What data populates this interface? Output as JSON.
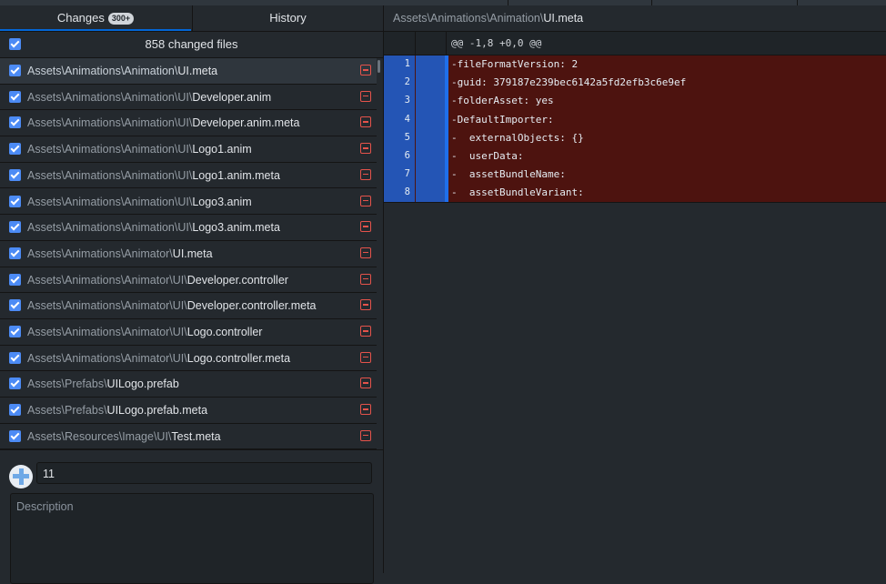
{
  "tabs": {
    "changes_label": "Changes",
    "changes_badge": "300+",
    "history_label": "History"
  },
  "changes_header": {
    "count_text": "858 changed files"
  },
  "files": [
    {
      "dir": "Assets\\Animations\\Animation\\",
      "name": "UI.meta",
      "selected": true
    },
    {
      "dir": "Assets\\Animations\\Animation\\UI\\",
      "name": "Developer.anim",
      "selected": false
    },
    {
      "dir": "Assets\\Animations\\Animation\\UI\\",
      "name": "Developer.anim.meta",
      "selected": false
    },
    {
      "dir": "Assets\\Animations\\Animation\\UI\\",
      "name": "Logo1.anim",
      "selected": false
    },
    {
      "dir": "Assets\\Animations\\Animation\\UI\\",
      "name": "Logo1.anim.meta",
      "selected": false
    },
    {
      "dir": "Assets\\Animations\\Animation\\UI\\",
      "name": "Logo3.anim",
      "selected": false
    },
    {
      "dir": "Assets\\Animations\\Animation\\UI\\",
      "name": "Logo3.anim.meta",
      "selected": false
    },
    {
      "dir": "Assets\\Animations\\Animator\\",
      "name": "UI.meta",
      "selected": false
    },
    {
      "dir": "Assets\\Animations\\Animator\\UI\\",
      "name": "Developer.controller",
      "selected": false
    },
    {
      "dir": "Assets\\Animations\\Animator\\UI\\",
      "name": "Developer.controller.meta",
      "selected": false
    },
    {
      "dir": "Assets\\Animations\\Animator\\UI\\",
      "name": "Logo.controller",
      "selected": false
    },
    {
      "dir": "Assets\\Animations\\Animator\\UI\\",
      "name": "Logo.controller.meta",
      "selected": false
    },
    {
      "dir": "Assets\\Prefabs\\",
      "name": "UILogo.prefab",
      "selected": false
    },
    {
      "dir": "Assets\\Prefabs\\",
      "name": "UILogo.prefab.meta",
      "selected": false
    },
    {
      "dir": "Assets\\Resources\\Image\\UI\\",
      "name": "Test.meta",
      "selected": false
    }
  ],
  "commit": {
    "summary_value": "11",
    "description_placeholder": "Description"
  },
  "diff": {
    "file_dir": "Assets\\Animations\\Animation\\",
    "file_name": "UI.meta",
    "hunk_header": "@@ -1,8 +0,0 @@",
    "lines": [
      {
        "num": "1",
        "text": "-fileFormatVersion: 2"
      },
      {
        "num": "2",
        "text": "-guid: 379187e239bec6142a5fd2efb3c6e9ef"
      },
      {
        "num": "3",
        "text": "-folderAsset: yes"
      },
      {
        "num": "4",
        "text": "-DefaultImporter:"
      },
      {
        "num": "5",
        "text": "-  externalObjects: {}"
      },
      {
        "num": "6",
        "text": "-  userData:"
      },
      {
        "num": "7",
        "text": "-  assetBundleName:"
      },
      {
        "num": "8",
        "text": "-  assetBundleVariant:"
      }
    ]
  },
  "colors": {
    "accent": "#0366d6",
    "deleted_bg": "#4d130f",
    "gutter_blue": "#2455b5",
    "delete_icon": "#e5534b"
  }
}
